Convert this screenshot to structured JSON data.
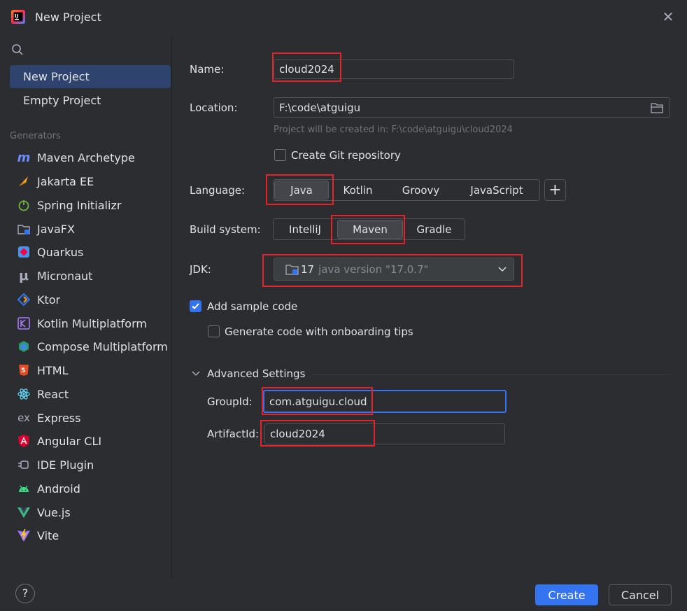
{
  "window": {
    "title": "New Project",
    "close_icon": "close-icon",
    "app_icon": "intellij-idea-icon"
  },
  "sidebar": {
    "search_icon": "search-icon",
    "nav": [
      {
        "label": "New Project",
        "selected": true
      },
      {
        "label": "Empty Project",
        "selected": false
      }
    ],
    "generators_label": "Generators",
    "generators": [
      {
        "label": "Maven Archetype",
        "icon": "maven-icon"
      },
      {
        "label": "Jakarta EE",
        "icon": "jakarta-ee-icon"
      },
      {
        "label": "Spring Initializr",
        "icon": "spring-icon"
      },
      {
        "label": "JavaFX",
        "icon": "javafx-icon"
      },
      {
        "label": "Quarkus",
        "icon": "quarkus-icon"
      },
      {
        "label": "Micronaut",
        "icon": "micronaut-icon"
      },
      {
        "label": "Ktor",
        "icon": "ktor-icon"
      },
      {
        "label": "Kotlin Multiplatform",
        "icon": "kotlin-multiplatform-icon"
      },
      {
        "label": "Compose Multiplatform",
        "icon": "compose-icon"
      },
      {
        "label": "HTML",
        "icon": "html5-icon"
      },
      {
        "label": "React",
        "icon": "react-icon"
      },
      {
        "label": "Express",
        "icon": "express-icon"
      },
      {
        "label": "Angular CLI",
        "icon": "angular-icon"
      },
      {
        "label": "IDE Plugin",
        "icon": "plugin-icon"
      },
      {
        "label": "Android",
        "icon": "android-icon"
      },
      {
        "label": "Vue.js",
        "icon": "vue-icon"
      },
      {
        "label": "Vite",
        "icon": "vite-icon"
      }
    ]
  },
  "form": {
    "name_label": "Name:",
    "name_value": "cloud2024",
    "location_label": "Location:",
    "location_value": "F:\\code\\atguigu",
    "location_hint": "Project will be created in: F:\\code\\atguigu\\cloud2024",
    "git_label": "Create Git repository",
    "git_checked": false,
    "language_label": "Language:",
    "languages": [
      "Java",
      "Kotlin",
      "Groovy",
      "JavaScript"
    ],
    "language_selected": "Java",
    "add_language_label": "+",
    "build_label": "Build system:",
    "build_systems": [
      "IntelliJ",
      "Maven",
      "Gradle"
    ],
    "build_selected": "Maven",
    "jdk_label": "JDK:",
    "jdk_version": "17",
    "jdk_detail": "java version \"17.0.7\"",
    "sample_label": "Add sample code",
    "sample_checked": true,
    "tips_label": "Generate code with onboarding tips",
    "tips_checked": false,
    "advanced_label": "Advanced Settings",
    "groupid_label": "GroupId:",
    "groupid_value": "com.atguigu.cloud",
    "artifactid_label": "ArtifactId:",
    "artifactid_value": "cloud2024"
  },
  "footer": {
    "help_label": "?",
    "create_label": "Create",
    "cancel_label": "Cancel"
  },
  "colors": {
    "accent": "#3574f0",
    "selected_bg": "#2e436e",
    "highlight": "#e3242b",
    "background": "#2b2d30"
  }
}
